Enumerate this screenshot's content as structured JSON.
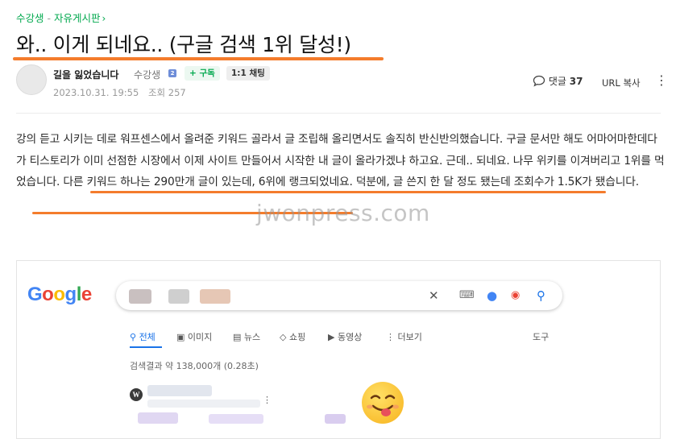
{
  "breadcrumb": {
    "board": "수강생",
    "separator": "-",
    "section": "자유게시판"
  },
  "post": {
    "title": "와.. 이게 되네요.. (구글 검색 1위 달성!)",
    "author": "길을 잃었습니다",
    "level": "수강생",
    "level_badge": "2",
    "subscribe_label": "+ 구독",
    "chat_label": "1:1 채팅",
    "date": "2023.10.31. 19:55",
    "views": "조회 257",
    "comments_label": "댓글",
    "comments_count": "37",
    "url_copy_label": "URL 복사",
    "paragraph": "강의 듣고 시키는 데로 워프센스에서 올려준 키워드 골라서 글 조립해 올리면서도 솔직히 반신반의했습니다. 구글 문서만 해도 어마어마한데다가 티스토리가 이미 선점한 시장에서 이제 사이트 만들어서 시작한 내 글이 올라가겠냐 하고요. 근데.. 되네요. 나무 위키를 이겨버리고 1위를 먹었습니다. 다른 키워드 하나는 290만개 글이 있는데, 6위에 랭크되었네요. 덕분에, 글 쓴지 한 달 정도 됐는데 조회수가 1.5K가 됐습니다."
  },
  "watermark": "jwonpress.com",
  "google": {
    "logo": "Google",
    "tabs": [
      "전체",
      "이미지",
      "뉴스",
      "쇼핑",
      "동영상",
      "더보기"
    ],
    "tools": "도구",
    "result_stats": "검색결과 약 138,000개 (0.28초)"
  },
  "colors": {
    "accent": "#03a94f",
    "underline": "#f47c2c",
    "google_blue": "#1a73e8"
  }
}
